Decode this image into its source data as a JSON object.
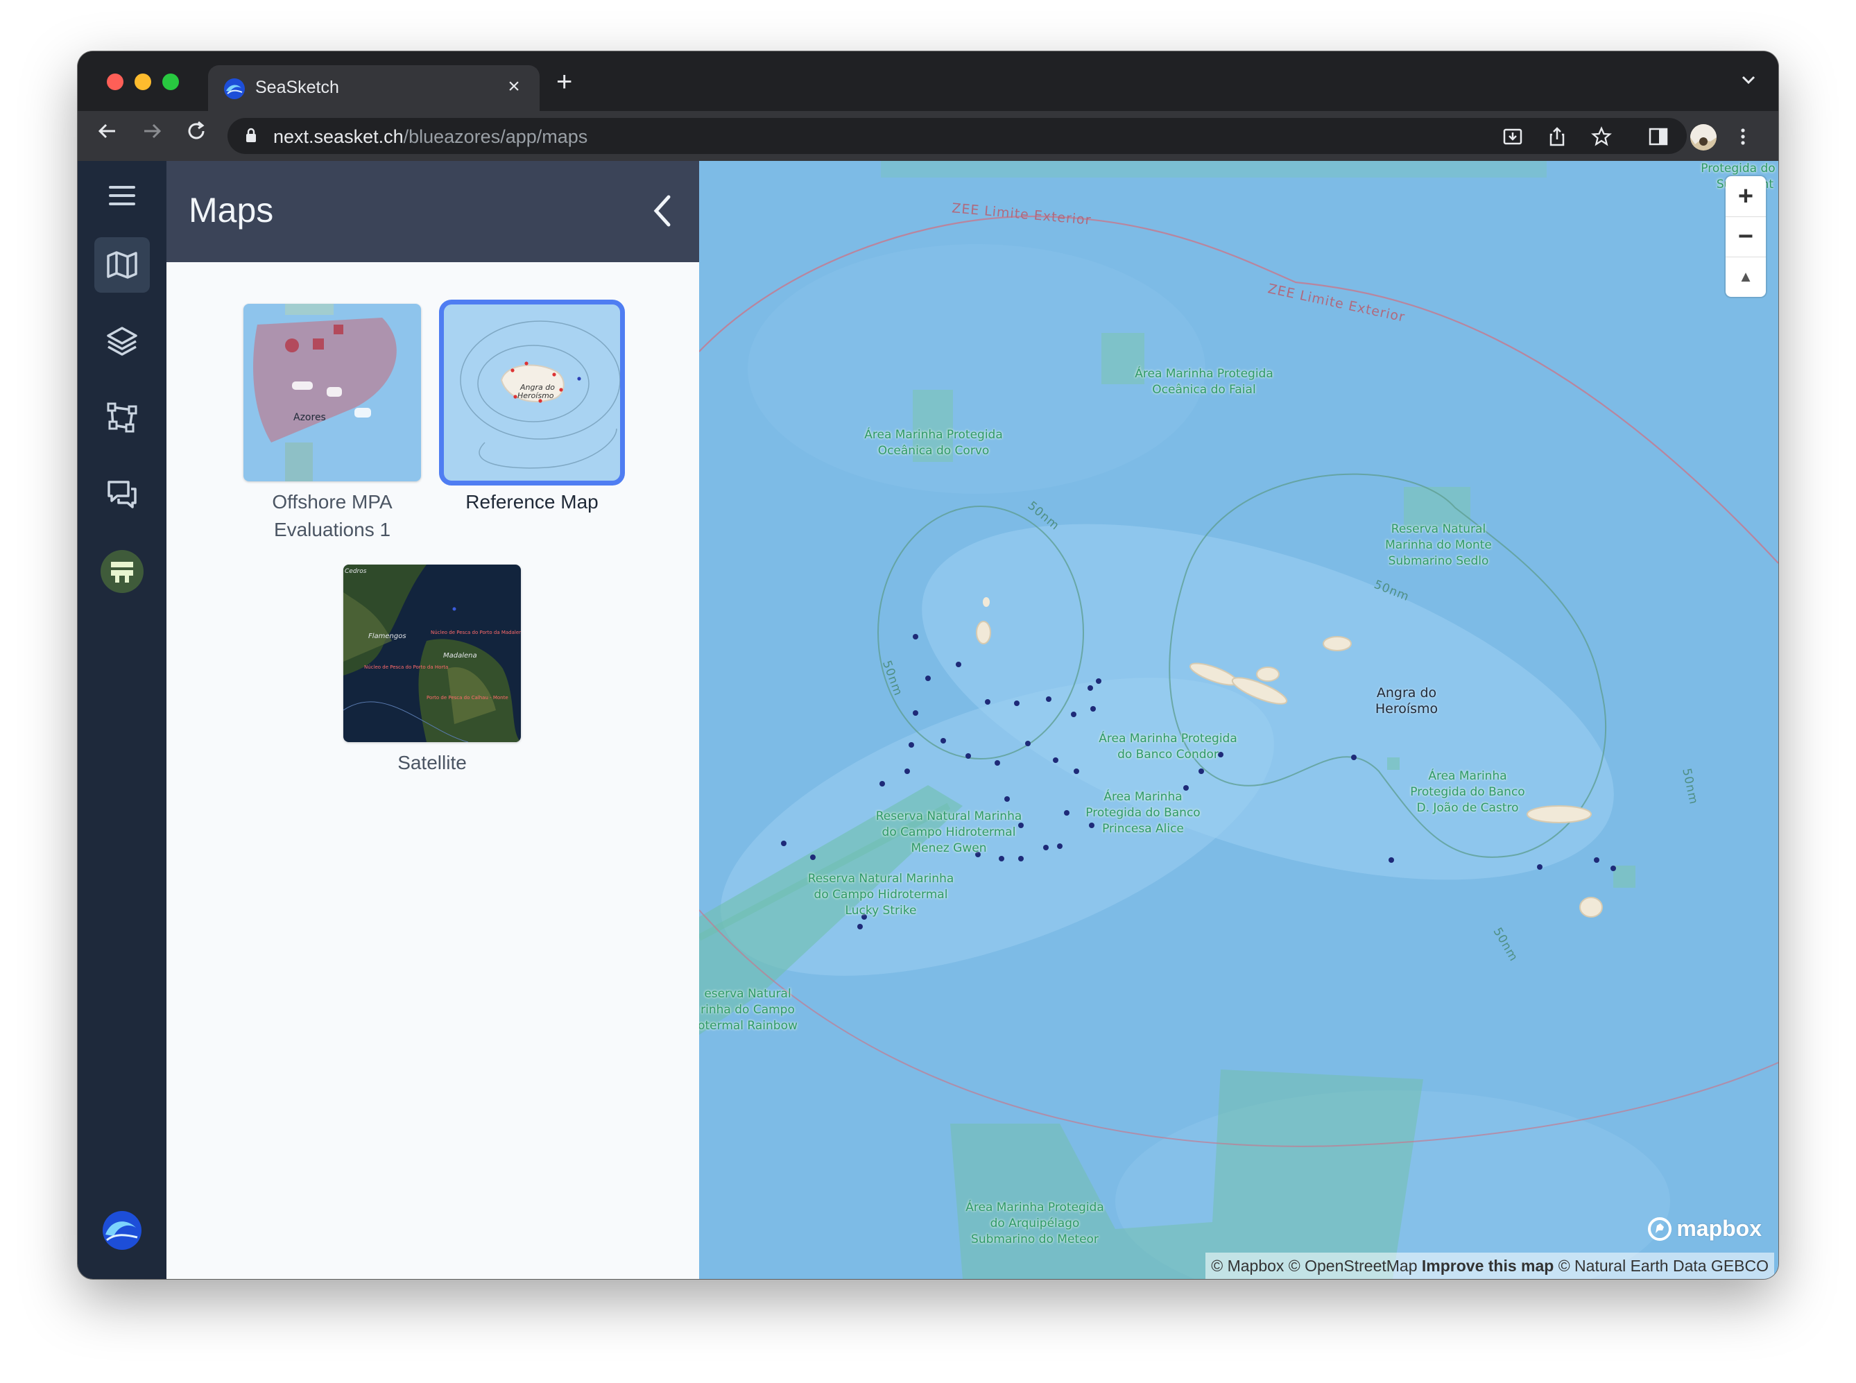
{
  "browser": {
    "tab_title": "SeaSketch",
    "tab_close": "×",
    "new_tab": "+",
    "tabs_menu": "⌄",
    "url_host": "next.seasket.ch",
    "url_path": "/blueazores/app/maps"
  },
  "sidebar": {
    "items": [
      {
        "name": "menu"
      },
      {
        "name": "maps",
        "active": true
      },
      {
        "name": "layers"
      },
      {
        "name": "sketches"
      },
      {
        "name": "forums"
      },
      {
        "name": "profile"
      },
      {
        "name": "seasketch-logo"
      }
    ]
  },
  "panel": {
    "title": "Maps",
    "cards": [
      {
        "label": "Offshore MPA Evaluations 1",
        "selected": false
      },
      {
        "label": "Reference Map",
        "selected": true
      },
      {
        "label": "Satellite",
        "selected": false
      }
    ],
    "thumbs": {
      "offshore_label": "Azores",
      "reference_label_1": "Angra do",
      "reference_label_2": "Heroísmo",
      "satellite_labels": [
        "Flamengos",
        "Madalena",
        "Núcleo de Pesca do Porto da Madalena",
        "Núcleo de Pesca do Porto da Horta",
        "Porto de Pesca do Calhau - Monte",
        "Cedros"
      ]
    }
  },
  "map": {
    "zee_label": "ZEE Limite Exterior",
    "nm_label": "50nm",
    "places": [
      {
        "text": "Área Marinha Protegida\nOceânica do Faial"
      },
      {
        "text": "Área Marinha Protegida\nOceânica do Corvo"
      },
      {
        "text": "Reserva Natural\nMarinha do Monte\nSubmarino Sedlo"
      },
      {
        "text": "Área Marinha Protegida\ndo Banco Condor"
      },
      {
        "text": "Área Marinha\nProtegida do Banco\nPrincesa Alice"
      },
      {
        "text": "Área Marinha\nProtegida do Banco\nD. João de Castro"
      },
      {
        "text": "Reserva Natural Marinha\ndo Campo Hidrotermal\nMenez Gwen"
      },
      {
        "text": "Reserva Natural Marinha\ndo Campo Hidrotermal\nLucky Strike"
      },
      {
        "text": "eserva Natural\nrinha do Campo\notermal Rainbow"
      },
      {
        "text": "Área Marinha Protegida\ndo Arquipélago\nSubmarino do Meteor"
      },
      {
        "text": "Protegida do M\nSubma      nt"
      }
    ],
    "city": "Angra do\nHeroísmo",
    "zoom_in": "+",
    "zoom_out": "−",
    "compass": "▲",
    "attribution_1": "© Mapbox © OpenStreetMap",
    "attribution_improve": "Improve this map",
    "attribution_2": "© Natural Earth Data GEBCO",
    "logo": "mapbox",
    "colors": {
      "sea": "#7dbbe6",
      "protected_area": "#6fbfb8",
      "accent": "#4f7df2"
    }
  }
}
